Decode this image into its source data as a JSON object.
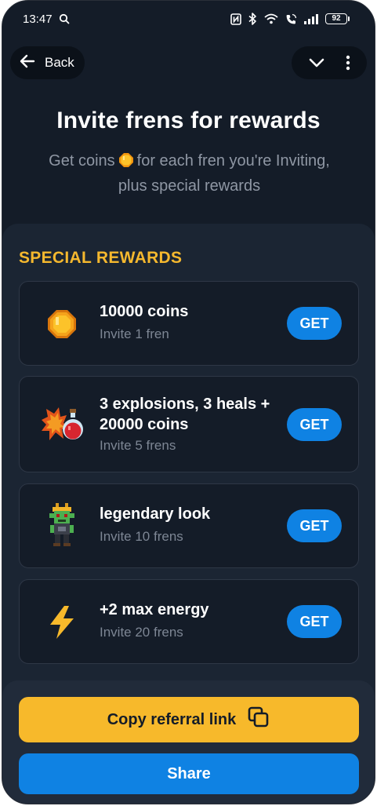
{
  "status": {
    "time": "13:47",
    "battery": "92"
  },
  "nav": {
    "back_label": "Back"
  },
  "header": {
    "title": "Invite frens for rewards",
    "subtitle_part1": "Get coins",
    "subtitle_part2": "for each fren you're Inviting, plus special rewards"
  },
  "rewards": {
    "section_title": "SPECIAL REWARDS",
    "items": [
      {
        "title": "10000 coins",
        "subtitle": "Invite 1 fren",
        "button": "GET",
        "icon": "coin-icon"
      },
      {
        "title": "3 explosions, 3 heals + 20000 coins",
        "subtitle": "Invite 5 frens",
        "button": "GET",
        "icon": "explosion-potion-icon"
      },
      {
        "title": "legendary look",
        "subtitle": "Invite 10 frens",
        "button": "GET",
        "icon": "goblin-character-icon"
      },
      {
        "title": "+2 max energy",
        "subtitle": "Invite 20 frens",
        "button": "GET",
        "icon": "lightning-icon"
      }
    ]
  },
  "actions": {
    "copy_label": "Copy referral link",
    "share_label": "Share"
  },
  "colors": {
    "background": "#141c28",
    "panel": "#1b2533",
    "accent_yellow": "#f7b92b",
    "accent_blue": "#0f82e3"
  }
}
